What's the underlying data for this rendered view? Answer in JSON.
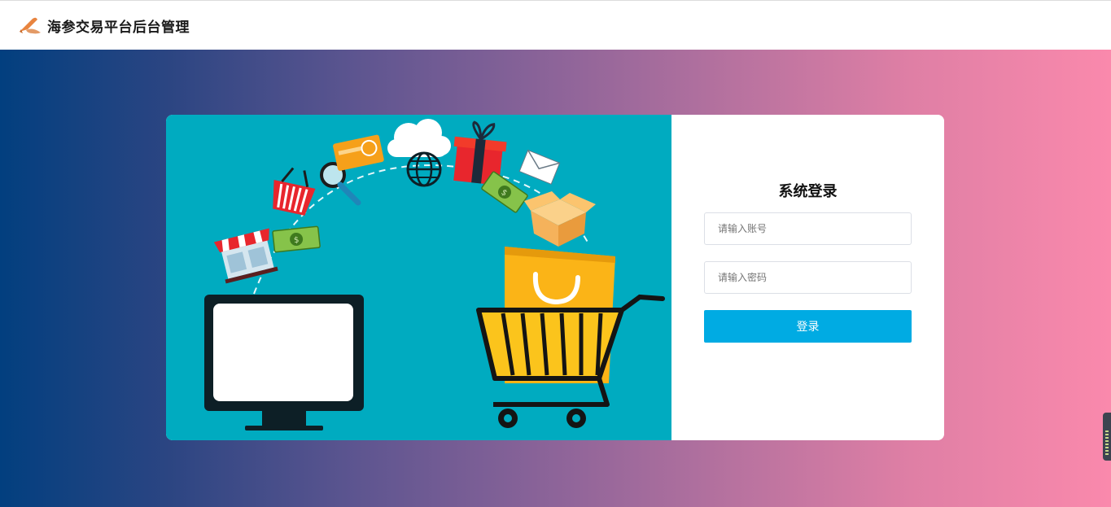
{
  "header": {
    "title": "海参交易平台后台管理",
    "logo_icon": "pen-logo-icon"
  },
  "login": {
    "title": "系统登录",
    "username_placeholder": "请输入账号",
    "password_placeholder": "请输入密码",
    "submit_label": "登录"
  },
  "colors": {
    "gradient_start": "#023f7f",
    "gradient_end": "#fa89ac",
    "illustration_bg": "#00abc0",
    "button": "#00abe3"
  },
  "illustration": {
    "icons": [
      "monitor-icon",
      "shopping-cart-icon",
      "shopping-bag-icon",
      "store-icon",
      "basket-icon",
      "magnifier-icon",
      "credit-card-icon",
      "cloud-icon",
      "globe-icon",
      "gift-icon",
      "envelope-icon",
      "money-icon",
      "box-icon"
    ]
  }
}
